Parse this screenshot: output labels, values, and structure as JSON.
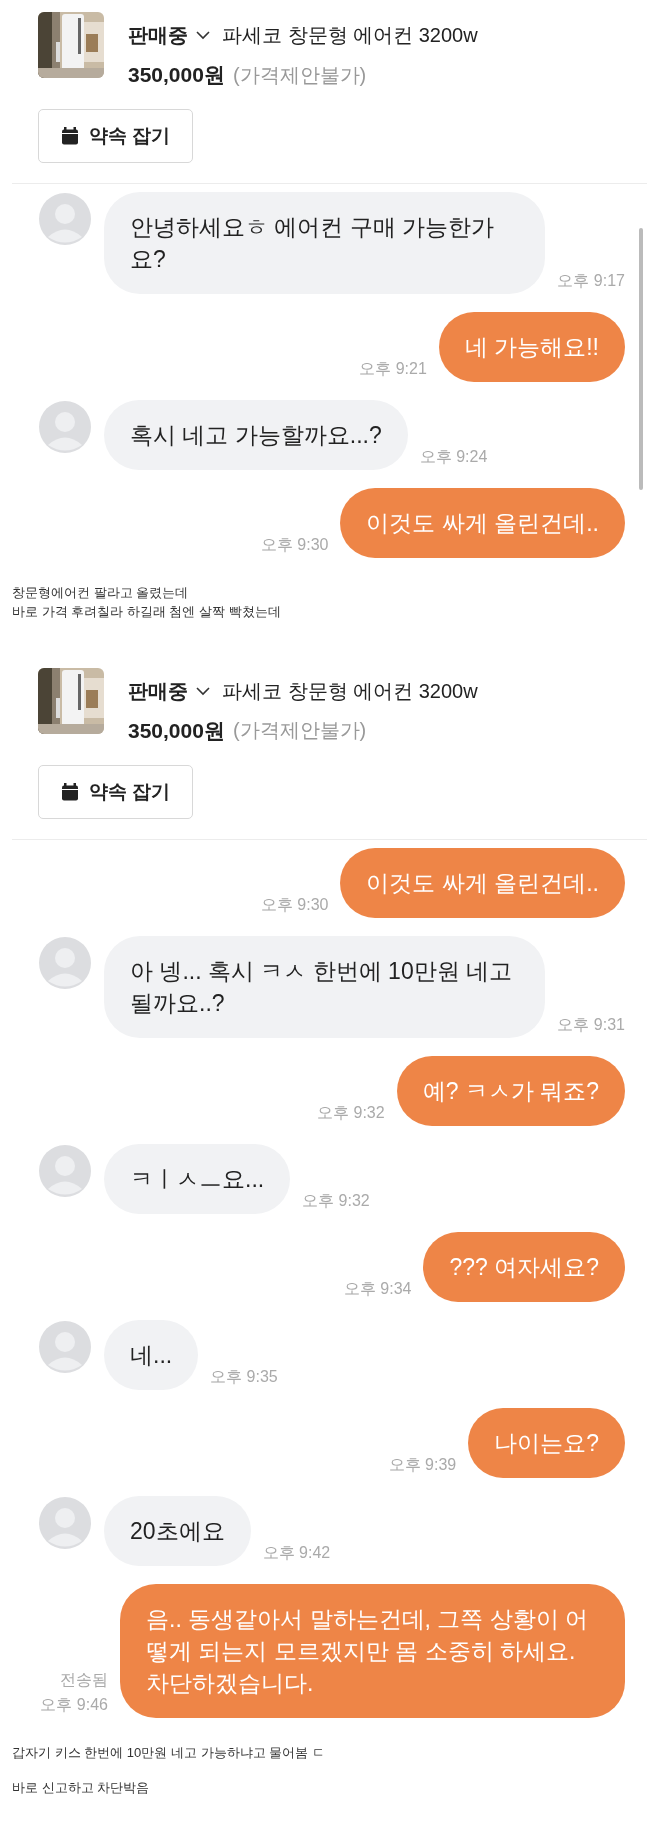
{
  "blocks": [
    {
      "kind": "chat",
      "scrollbar": true,
      "product": {
        "status": "판매중",
        "title": "파세코 창문형 에어컨 3200w",
        "price": "350,000원",
        "note": "(가격제안불가)"
      },
      "button": "약속 잡기",
      "messages": [
        {
          "sent": false,
          "text": "안녕하세요ㅎ 에어컨 구매 가능한가요?",
          "time": "오후 9:17"
        },
        {
          "sent": true,
          "text": "네 가능해요!!",
          "time": "오후 9:21"
        },
        {
          "sent": false,
          "text": "혹시 네고 가능할까요...?",
          "time": "오후 9:24"
        },
        {
          "sent": true,
          "text": "이것도 싸게 올린건데..",
          "time": "오후 9:30"
        }
      ]
    },
    {
      "kind": "caption",
      "lines": [
        "창문형에어컨 팔라고 올렸는데",
        "바로 가격 후려칠라 하길래 첨엔 살짝 빡쳤는데"
      ]
    },
    {
      "kind": "chat",
      "product": {
        "status": "판매중",
        "title": "파세코 창문형 에어컨 3200w",
        "price": "350,000원",
        "note": "(가격제안불가)"
      },
      "button": "약속 잡기",
      "messages": [
        {
          "sent": true,
          "text": "이것도 싸게 올린건데..",
          "time": "오후 9:30"
        },
        {
          "sent": false,
          "text": "아 넹... 혹시 ㅋㅅ 한번에 10만원 네고 될까요..?",
          "time": "오후 9:31"
        },
        {
          "sent": true,
          "text": "예? ㅋㅅ가 뭐죠?",
          "time": "오후 9:32"
        },
        {
          "sent": false,
          "text": "ㅋㅣㅅㅡ요...",
          "time": "오후 9:32"
        },
        {
          "sent": true,
          "text": "??? 여자세요?",
          "time": "오후 9:34"
        },
        {
          "sent": false,
          "text": "네...",
          "time": "오후 9:35"
        },
        {
          "sent": true,
          "text": "나이는요?",
          "time": "오후 9:39"
        },
        {
          "sent": false,
          "text": "20초에요",
          "time": "오후 9:42"
        },
        {
          "sent": true,
          "text": "음.. 동생같아서 말하는건데, 그쪽 상황이 어떻게 되는지 모르겠지만 몸 소중히 하세요. 차단하겠습니다.",
          "time": "오후 9:46",
          "status": "전송됨"
        }
      ]
    },
    {
      "kind": "caption",
      "lines": [
        "갑자기 키스 한번에 10만원 네고 가능하냐고 물어봄 ㄷ"
      ]
    },
    {
      "kind": "caption",
      "lines": [
        "바로 신고하고 차단박음"
      ]
    }
  ]
}
